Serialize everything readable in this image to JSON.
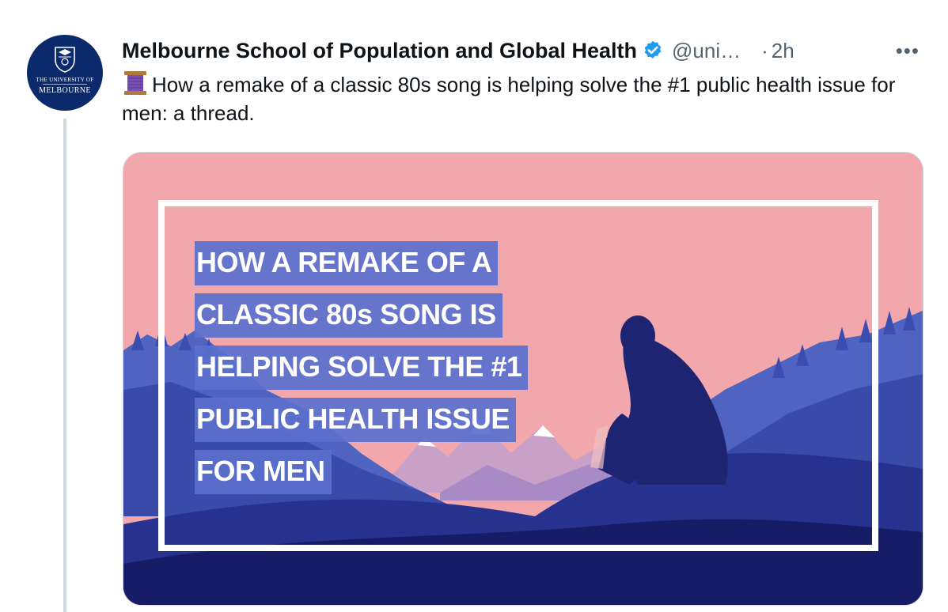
{
  "author": {
    "name": "Melbourne School of Population and Global Health",
    "handle": "@uni…",
    "separator": "·",
    "time": "2h",
    "verified": true,
    "avatar_line1": "THE UNIVERSITY OF",
    "avatar_line2": "MELBOURNE"
  },
  "tweet": {
    "emoji": "thread-spool-icon",
    "text": "How a remake of a classic 80s song is helping solve the #1 public health issue for men: a thread."
  },
  "more_label": "•••",
  "media": {
    "headline_lines": [
      "HOW A REMAKE OF A",
      "CLASSIC 80s SONG IS",
      "HELPING SOLVE THE  #1",
      "PUBLIC HEALTH ISSUE",
      "FOR MEN"
    ]
  },
  "colors": {
    "brand_navy": "#0b2a6b",
    "verified_blue": "#1d9bf0",
    "media_pink": "#f2a7ac",
    "headline_highlight": "#5b70cd",
    "secondary_text": "#536471"
  }
}
